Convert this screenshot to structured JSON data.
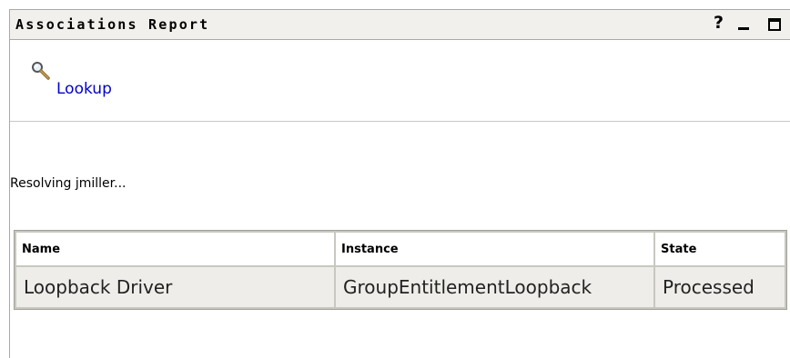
{
  "portlet": {
    "title": "Associations Report",
    "help_label": "?"
  },
  "actions": {
    "lookup_label": "Lookup"
  },
  "status": {
    "text": "Resolving jmiller..."
  },
  "table": {
    "columns": [
      "Name",
      "Instance",
      "State"
    ],
    "rows": [
      [
        "Loopback Driver",
        "GroupEntitlementLoopback",
        "Processed"
      ]
    ]
  }
}
